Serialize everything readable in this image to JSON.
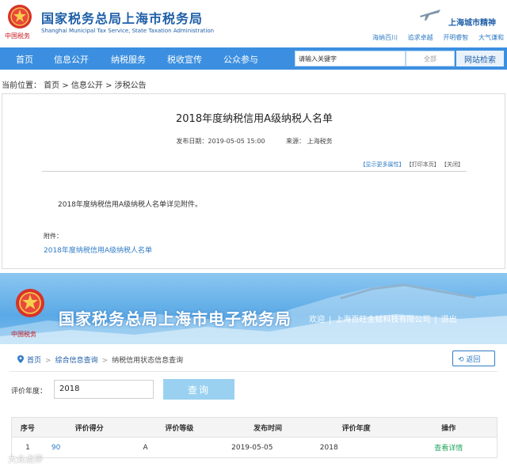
{
  "top_site": {
    "seal_text": "中国税务",
    "title": "国家税务总局上海市税务局",
    "subtitle": "Shanghai Municipal Tax Service, State Taxation Administration",
    "spirit": "上海城市精神",
    "mottos": [
      "海纳百川",
      "追求卓越",
      "开明睿智",
      "大气谦和"
    ],
    "nav": [
      "首页",
      "信息公开",
      "纳税服务",
      "税收宣传",
      "公众参与"
    ],
    "search_value": "请输入关键字",
    "search_scope": "全部",
    "search_button": "网站检索",
    "breadcrumb": "当前位置： 首页 > 信息公开 > 涉税公告"
  },
  "article": {
    "title": "2018年度纳税信用A级纳税人名单",
    "date": "发布日期：2019-05-05 15:00",
    "source": "来源： 上海税务",
    "tool_more": "【显示更多属性】",
    "tool_print": "【打印本页】",
    "tool_close": "【关闭】",
    "body": "2018年度纳税信用A级纳税人名单详见附件。",
    "attachment_label": "附件：",
    "attachment_link": "2018年度纳税信用A级纳税人名单"
  },
  "etax": {
    "seal_text": "中国税务",
    "title": "国家税务总局上海市电子税务局",
    "welcome": "欢迎",
    "company": "上海百旺金赋科技有限公司",
    "logout": "退出",
    "crumb_home": "首页",
    "crumb_query": "综合信息查询",
    "crumb_current": "纳税信用状态信息查询",
    "back": "返回",
    "year_label": "评价年度：",
    "year_value": "2018",
    "query_button": "查询",
    "table": {
      "headers": [
        "序号",
        "评价得分",
        "评价等级",
        "发布时间",
        "评价年度",
        "操作"
      ],
      "rows": [
        [
          "1",
          "90",
          "A",
          "2019-05-05",
          "2018",
          "查看详情"
        ]
      ]
    }
  },
  "watermark": "大众点评",
  "colors": {
    "brand_blue": "#1f5fa8",
    "nav_blue": "#3c8fe0",
    "seal_red": "#c8161d",
    "link_blue": "#2f7bc4",
    "action_green": "#22a45d"
  }
}
